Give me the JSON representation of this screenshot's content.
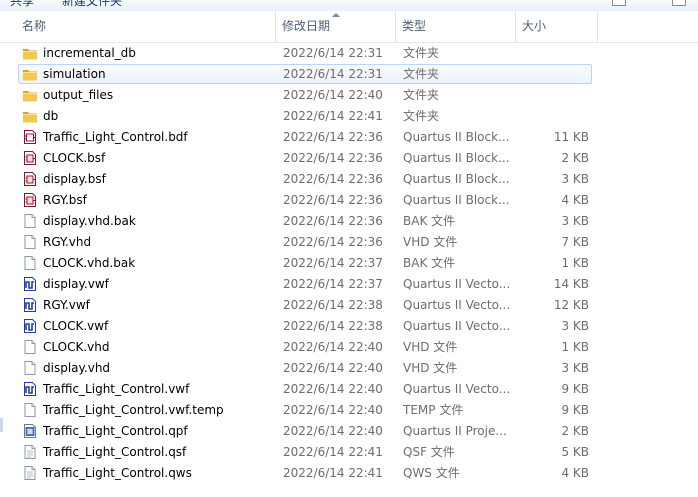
{
  "toolbar": {
    "items": [
      {
        "label": "共享"
      },
      {
        "label": "新建文件夹"
      }
    ]
  },
  "columns": {
    "name": "名称",
    "date": "修改日期",
    "type": "类型",
    "size": "大小"
  },
  "files": [
    {
      "name": "incremental_db",
      "date": "2022/6/14 22:31",
      "type": "文件夹",
      "size": "",
      "icon": "folder-icon"
    },
    {
      "name": "simulation",
      "date": "2022/6/14 22:31",
      "type": "文件夹",
      "size": "",
      "icon": "folder-icon",
      "hover": true
    },
    {
      "name": "output_files",
      "date": "2022/6/14 22:40",
      "type": "文件夹",
      "size": "",
      "icon": "folder-icon"
    },
    {
      "name": "db",
      "date": "2022/6/14 22:41",
      "type": "文件夹",
      "size": "",
      "icon": "folder-icon"
    },
    {
      "name": "Traffic_Light_Control.bdf",
      "date": "2022/6/14 22:36",
      "type": "Quartus II Block...",
      "size": "11 KB",
      "icon": "bdf-file-icon"
    },
    {
      "name": "CLOCK.bsf",
      "date": "2022/6/14 22:36",
      "type": "Quartus II Block...",
      "size": "2 KB",
      "icon": "bsf-file-icon"
    },
    {
      "name": "display.bsf",
      "date": "2022/6/14 22:36",
      "type": "Quartus II Block...",
      "size": "3 KB",
      "icon": "bsf-file-icon"
    },
    {
      "name": "RGY.bsf",
      "date": "2022/6/14 22:36",
      "type": "Quartus II Block...",
      "size": "4 KB",
      "icon": "bsf-file-icon"
    },
    {
      "name": "display.vhd.bak",
      "date": "2022/6/14 22:36",
      "type": "BAK 文件",
      "size": "3 KB",
      "icon": "blank-file-icon"
    },
    {
      "name": "RGY.vhd",
      "date": "2022/6/14 22:36",
      "type": "VHD 文件",
      "size": "7 KB",
      "icon": "blank-file-icon"
    },
    {
      "name": "CLOCK.vhd.bak",
      "date": "2022/6/14 22:37",
      "type": "BAK 文件",
      "size": "1 KB",
      "icon": "blank-file-icon"
    },
    {
      "name": "display.vwf",
      "date": "2022/6/14 22:37",
      "type": "Quartus II Vecto...",
      "size": "14 KB",
      "icon": "vwf-file-icon"
    },
    {
      "name": "RGY.vwf",
      "date": "2022/6/14 22:38",
      "type": "Quartus II Vecto...",
      "size": "12 KB",
      "icon": "vwf-file-icon"
    },
    {
      "name": "CLOCK.vwf",
      "date": "2022/6/14 22:38",
      "type": "Quartus II Vecto...",
      "size": "3 KB",
      "icon": "vwf-file-icon"
    },
    {
      "name": "CLOCK.vhd",
      "date": "2022/6/14 22:40",
      "type": "VHD 文件",
      "size": "1 KB",
      "icon": "blank-file-icon"
    },
    {
      "name": "display.vhd",
      "date": "2022/6/14 22:40",
      "type": "VHD 文件",
      "size": "3 KB",
      "icon": "blank-file-icon"
    },
    {
      "name": "Traffic_Light_Control.vwf",
      "date": "2022/6/14 22:40",
      "type": "Quartus II Vecto...",
      "size": "9 KB",
      "icon": "vwf-file-icon"
    },
    {
      "name": "Traffic_Light_Control.vwf.temp",
      "date": "2022/6/14 22:40",
      "type": "TEMP 文件",
      "size": "9 KB",
      "icon": "blank-file-icon"
    },
    {
      "name": "Traffic_Light_Control.qpf",
      "date": "2022/6/14 22:40",
      "type": "Quartus II Proje...",
      "size": "2 KB",
      "icon": "qpf-file-icon"
    },
    {
      "name": "Traffic_Light_Control.qsf",
      "date": "2022/6/14 22:41",
      "type": "QSF 文件",
      "size": "5 KB",
      "icon": "text-file-icon"
    },
    {
      "name": "Traffic_Light_Control.qws",
      "date": "2022/6/14 22:41",
      "type": "QWS 文件",
      "size": "4 KB",
      "icon": "text-file-icon"
    }
  ],
  "colors": {
    "folder": "#e8b93c",
    "selection_border": "#b8d6fb",
    "vwf_blue": "#1f3fa8",
    "bsf_red": "#a3122f"
  }
}
